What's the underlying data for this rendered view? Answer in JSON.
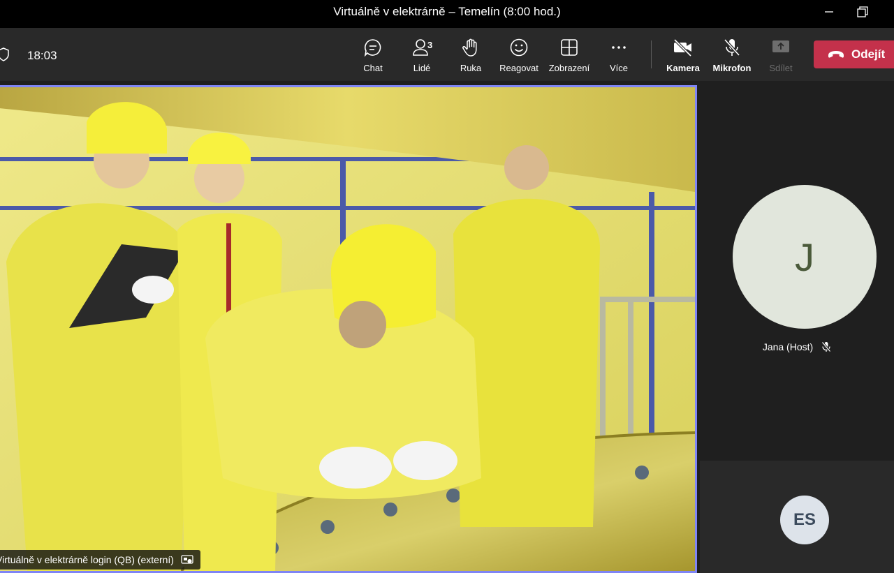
{
  "window": {
    "title": "Virtuálně v elektrárně – Temelín (8:00 hod.)"
  },
  "toolbar": {
    "clock": "18:03",
    "chat_label": "Chat",
    "people_label": "Lidé",
    "people_count": "3",
    "raise_hand_label": "Ruka",
    "react_label": "Reagovat",
    "view_label": "Zobrazení",
    "more_label": "Více",
    "camera_label": "Kamera",
    "mic_label": "Mikrofon",
    "share_label": "Sdílet",
    "leave_label": "Odejít"
  },
  "main_video": {
    "caption": "Virtuálně v elektrárně login (QB) (externí)"
  },
  "participants": [
    {
      "initials": "J",
      "name": "Jana (Host)",
      "muted": true
    },
    {
      "initials": "ES"
    }
  ],
  "colors": {
    "accent": "#7f85f5",
    "leave": "#c4314b",
    "toolbar": "#292929"
  }
}
